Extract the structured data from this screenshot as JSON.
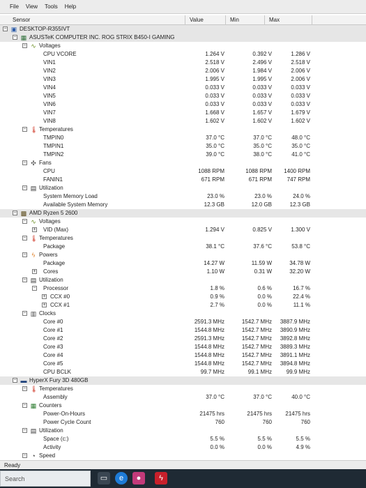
{
  "menu": [
    "File",
    "View",
    "Tools",
    "Help"
  ],
  "columns": {
    "sensor": "Sensor",
    "value": "Value",
    "min": "Min",
    "max": "Max"
  },
  "rows": [
    {
      "label": "DESKTOP-R355IVT",
      "indent": 0,
      "type": "root",
      "icon": "computer-icon"
    },
    {
      "label": "ASUSTeK COMPUTER INC. ROG STRIX B450-I GAMING",
      "indent": 1,
      "type": "device",
      "icon": "motherboard-icon"
    },
    {
      "label": "Voltages",
      "indent": 2,
      "type": "group",
      "icon": "voltage-icon"
    },
    {
      "label": "CPU VCORE",
      "indent": 3,
      "value": "1.264 V",
      "min": "0.392 V",
      "max": "1.286 V"
    },
    {
      "label": "VIN1",
      "indent": 3,
      "value": "2.518 V",
      "min": "2.496 V",
      "max": "2.518 V"
    },
    {
      "label": "VIN2",
      "indent": 3,
      "value": "2.006 V",
      "min": "1.984 V",
      "max": "2.006 V"
    },
    {
      "label": "VIN3",
      "indent": 3,
      "value": "1.995 V",
      "min": "1.995 V",
      "max": "2.006 V"
    },
    {
      "label": "VIN4",
      "indent": 3,
      "value": "0.033 V",
      "min": "0.033 V",
      "max": "0.033 V"
    },
    {
      "label": "VIN5",
      "indent": 3,
      "value": "0.033 V",
      "min": "0.033 V",
      "max": "0.033 V"
    },
    {
      "label": "VIN6",
      "indent": 3,
      "value": "0.033 V",
      "min": "0.033 V",
      "max": "0.033 V"
    },
    {
      "label": "VIN7",
      "indent": 3,
      "value": "1.668 V",
      "min": "1.657 V",
      "max": "1.679 V"
    },
    {
      "label": "VIN8",
      "indent": 3,
      "value": "1.602 V",
      "min": "1.602 V",
      "max": "1.602 V"
    },
    {
      "label": "Temperatures",
      "indent": 2,
      "type": "group",
      "icon": "thermometer-icon"
    },
    {
      "label": "TMPIN0",
      "indent": 3,
      "value": "37.0 °C",
      "min": "37.0 °C",
      "max": "48.0 °C"
    },
    {
      "label": "TMPIN1",
      "indent": 3,
      "value": "35.0 °C",
      "min": "35.0 °C",
      "max": "35.0 °C"
    },
    {
      "label": "TMPIN2",
      "indent": 3,
      "value": "39.0 °C",
      "min": "38.0 °C",
      "max": "41.0 °C"
    },
    {
      "label": "Fans",
      "indent": 2,
      "type": "group",
      "icon": "fan-icon"
    },
    {
      "label": "CPU",
      "indent": 3,
      "value": "1088 RPM",
      "min": "1088 RPM",
      "max": "1400 RPM"
    },
    {
      "label": "FANIN1",
      "indent": 3,
      "value": "671 RPM",
      "min": "671 RPM",
      "max": "747 RPM"
    },
    {
      "label": "Utilization",
      "indent": 2,
      "type": "group",
      "icon": "utilization-icon"
    },
    {
      "label": "System Memory Load",
      "indent": 3,
      "value": "23.0 %",
      "min": "23.0 %",
      "max": "24.0 %"
    },
    {
      "label": "Available System Memory",
      "indent": 3,
      "value": "12.3 GB",
      "min": "12.0 GB",
      "max": "12.3 GB"
    },
    {
      "label": "AMD Ryzen 5 2600",
      "indent": 1,
      "type": "device",
      "icon": "cpu-icon"
    },
    {
      "label": "Voltages",
      "indent": 2,
      "type": "group",
      "icon": "voltage-icon"
    },
    {
      "label": "VID (Max)",
      "indent": 3,
      "expand": true,
      "value": "1.294 V",
      "min": "0.825 V",
      "max": "1.300 V"
    },
    {
      "label": "Temperatures",
      "indent": 2,
      "type": "group",
      "icon": "thermometer-icon"
    },
    {
      "label": "Package",
      "indent": 3,
      "value": "38.1 °C",
      "min": "37.6 °C",
      "max": "53.8 °C"
    },
    {
      "label": "Powers",
      "indent": 2,
      "type": "group",
      "icon": "power-icon"
    },
    {
      "label": "Package",
      "indent": 3,
      "value": "14.27 W",
      "min": "11.59 W",
      "max": "34.78 W"
    },
    {
      "label": "Cores",
      "indent": 3,
      "expand": true,
      "value": "1.10 W",
      "min": "0.31 W",
      "max": "32.20 W"
    },
    {
      "label": "Utilization",
      "indent": 2,
      "type": "group",
      "icon": "utilization-icon"
    },
    {
      "label": "Processor",
      "indent": 3,
      "expand": true,
      "expanded": true,
      "value": "1.8 %",
      "min": "0.6 %",
      "max": "16.7 %"
    },
    {
      "label": "CCX #0",
      "indent": 4,
      "expand": true,
      "value": "0.9 %",
      "min": "0.0 %",
      "max": "22.4 %"
    },
    {
      "label": "CCX #1",
      "indent": 4,
      "expand": true,
      "value": "2.7 %",
      "min": "0.0 %",
      "max": "11.1 %"
    },
    {
      "label": "Clocks",
      "indent": 2,
      "type": "group",
      "icon": "clock-icon"
    },
    {
      "label": "Core #0",
      "indent": 3,
      "value": "2591.3 MHz",
      "min": "1542.7 MHz",
      "max": "3887.9 MHz"
    },
    {
      "label": "Core #1",
      "indent": 3,
      "value": "1544.8 MHz",
      "min": "1542.7 MHz",
      "max": "3890.9 MHz"
    },
    {
      "label": "Core #2",
      "indent": 3,
      "value": "2591.3 MHz",
      "min": "1542.7 MHz",
      "max": "3892.8 MHz"
    },
    {
      "label": "Core #3",
      "indent": 3,
      "value": "1544.8 MHz",
      "min": "1542.7 MHz",
      "max": "3889.3 MHz"
    },
    {
      "label": "Core #4",
      "indent": 3,
      "value": "1544.8 MHz",
      "min": "1542.7 MHz",
      "max": "3891.1 MHz"
    },
    {
      "label": "Core #5",
      "indent": 3,
      "value": "1544.8 MHz",
      "min": "1542.7 MHz",
      "max": "3894.8 MHz"
    },
    {
      "label": "CPU BCLK",
      "indent": 3,
      "value": "99.7 MHz",
      "min": "99.1 MHz",
      "max": "99.9 MHz"
    },
    {
      "label": "HyperX Fury 3D 480GB",
      "indent": 1,
      "type": "device",
      "icon": "drive-icon"
    },
    {
      "label": "Temperatures",
      "indent": 2,
      "type": "group",
      "icon": "thermometer-icon"
    },
    {
      "label": "Assembly",
      "indent": 3,
      "value": "37.0 °C",
      "min": "37.0 °C",
      "max": "40.0 °C"
    },
    {
      "label": "Counters",
      "indent": 2,
      "type": "group",
      "icon": "counter-icon"
    },
    {
      "label": "Power-On-Hours",
      "indent": 3,
      "value": "21475 hrs",
      "min": "21475 hrs",
      "max": "21475 hrs"
    },
    {
      "label": "Power Cycle Count",
      "indent": 3,
      "value": "760",
      "min": "760",
      "max": "760"
    },
    {
      "label": "Utilization",
      "indent": 2,
      "type": "group",
      "icon": "utilization-icon"
    },
    {
      "label": "Space (c:)",
      "indent": 3,
      "value": "5.5 %",
      "min": "5.5 %",
      "max": "5.5 %"
    },
    {
      "label": "Activity",
      "indent": 3,
      "value": "0.0 %",
      "min": "0.0 %",
      "max": "4.9 %"
    },
    {
      "label": "Speed",
      "indent": 2,
      "type": "group",
      "icon": "speed-icon"
    }
  ],
  "status": "Ready",
  "taskbar": {
    "search_placeholder": "Search"
  },
  "colors": {
    "accent_thermo": "#d03a2a",
    "accent_voltage": "#6b8e23",
    "selection": "#dedede"
  }
}
